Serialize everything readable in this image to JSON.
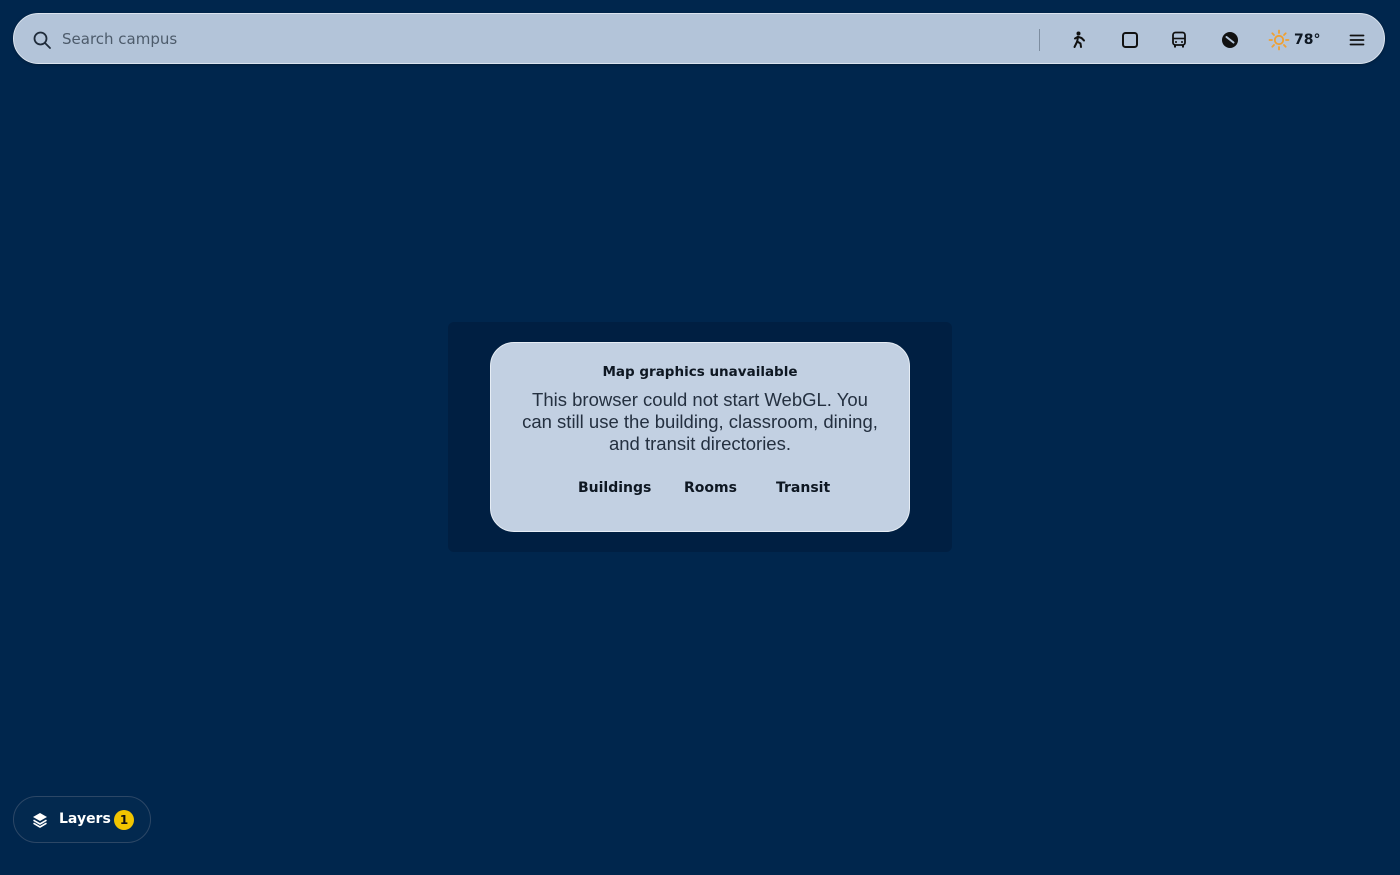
{
  "search": {
    "placeholder": "Search campus",
    "value": ""
  },
  "toolbar": {
    "icons": [
      "accessibility-icon",
      "square-icon",
      "bus-icon",
      "compass-icon",
      "sun-icon",
      "menu-icon"
    ],
    "weather": {
      "temperature": "78°",
      "icon": "sun-icon",
      "icon_color": "#f0a030"
    }
  },
  "dialog": {
    "title": "Map graphics unavailable",
    "body": "This browser could not start WebGL. You can still use the building, classroom, dining, and transit directories.",
    "actions": {
      "buildings": "Buildings",
      "rooms": "Rooms",
      "transit": "Transit"
    }
  },
  "layers": {
    "label": "Layers",
    "count": "1",
    "badge_color": "#f2c500"
  },
  "colors": {
    "background": "#00264d",
    "panel": "#b3c4d9",
    "dialog": "#c2d0e2"
  }
}
